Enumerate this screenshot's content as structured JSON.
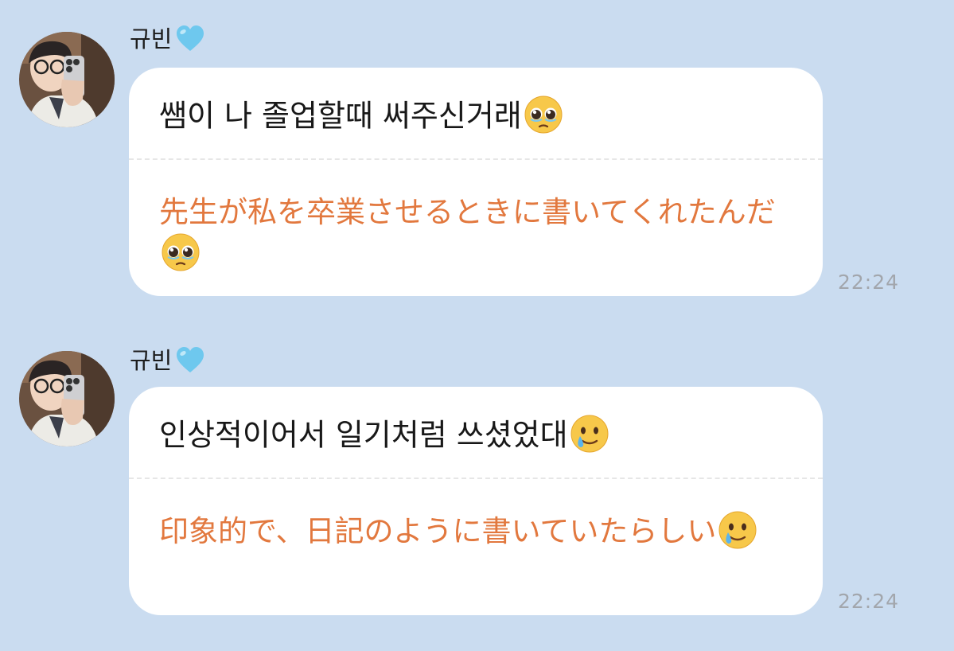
{
  "theme": {
    "background": "#cadcf0",
    "bubble": "#ffffff",
    "translation_color": "#e2783e",
    "time_color": "#a2a6ac",
    "heart_color": "#6ec8ee"
  },
  "messages": [
    {
      "sender": "규빈",
      "sender_icon": "light-blue-heart-icon",
      "text": "쌤이 나 졸업할때 써주신거래",
      "text_emoji": "pleading-face-icon",
      "translation": "先生が私を卒業させるときに書いてくれたんだ",
      "translation_emoji": "pleading-face-icon",
      "time": "22:24"
    },
    {
      "sender": "규빈",
      "sender_icon": "light-blue-heart-icon",
      "text": "인상적이어서 일기처럼 쓰셨었대",
      "text_emoji": "smiling-face-with-tear-icon",
      "translation": "印象的で、日記のように書いていたらしい",
      "translation_emoji": "smiling-face-with-tear-icon",
      "time": "22:24"
    }
  ]
}
